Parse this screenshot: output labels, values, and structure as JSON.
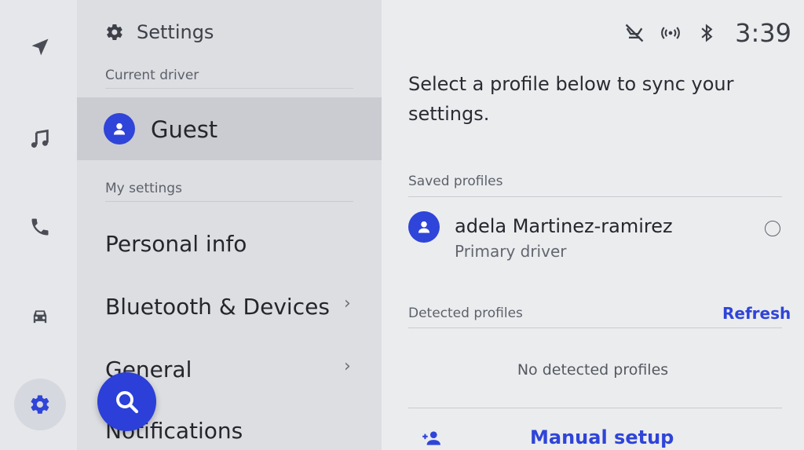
{
  "rail": {
    "items": [
      {
        "name": "navigation",
        "icon": "navigation-arrow-icon"
      },
      {
        "name": "music",
        "icon": "music-note-icon"
      },
      {
        "name": "phone",
        "icon": "phone-icon"
      },
      {
        "name": "vehicle",
        "icon": "car-icon"
      },
      {
        "name": "settings",
        "icon": "gear-icon",
        "active": true
      }
    ]
  },
  "menu": {
    "title": "Settings",
    "current_driver_label": "Current driver",
    "current_driver_name": "Guest",
    "my_settings_label": "My settings",
    "items": [
      {
        "label": "Personal info",
        "chevron": false
      },
      {
        "label": "Bluetooth & Devices",
        "chevron": true
      },
      {
        "label": "General",
        "chevron": true
      },
      {
        "label": "Notifications",
        "chevron": false
      }
    ],
    "chevron_glyph": "›"
  },
  "status": {
    "icons": [
      "voice-muted-icon",
      "wireless-signal-icon",
      "bluetooth-icon"
    ],
    "time": "3:39"
  },
  "main": {
    "prompt": "Select a profile below to sync your settings.",
    "saved_profiles_label": "Saved profiles",
    "saved_profiles": [
      {
        "name": "adela Martinez-ramirez",
        "role": "Primary driver"
      }
    ],
    "detected_profiles_label": "Detected profiles",
    "refresh_label": "Refresh",
    "no_detected_text": "No detected profiles",
    "manual_setup_label": "Manual setup"
  },
  "colors": {
    "accent": "#2f44d8",
    "selected_row": "#cbccd2",
    "menu_bg": "#dddee2",
    "main_bg": "#ebecee"
  }
}
